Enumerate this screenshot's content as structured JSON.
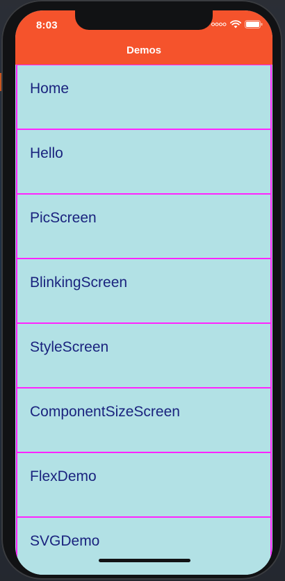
{
  "status_bar": {
    "time": "8:03",
    "icons": [
      "signal-dots-icon",
      "wifi-icon",
      "battery-icon"
    ]
  },
  "nav": {
    "title": "Demos"
  },
  "list": {
    "items": [
      {
        "label": "Home"
      },
      {
        "label": "Hello"
      },
      {
        "label": "PicScreen"
      },
      {
        "label": "BlinkingScreen"
      },
      {
        "label": "StyleScreen"
      },
      {
        "label": "ComponentSizeScreen"
      },
      {
        "label": "FlexDemo"
      },
      {
        "label": "SVGDemo"
      }
    ]
  },
  "colors": {
    "header": "#f5532c",
    "item_background": "#b2e1e5",
    "item_border": "#ff23ff",
    "item_text": "#1a237e"
  }
}
